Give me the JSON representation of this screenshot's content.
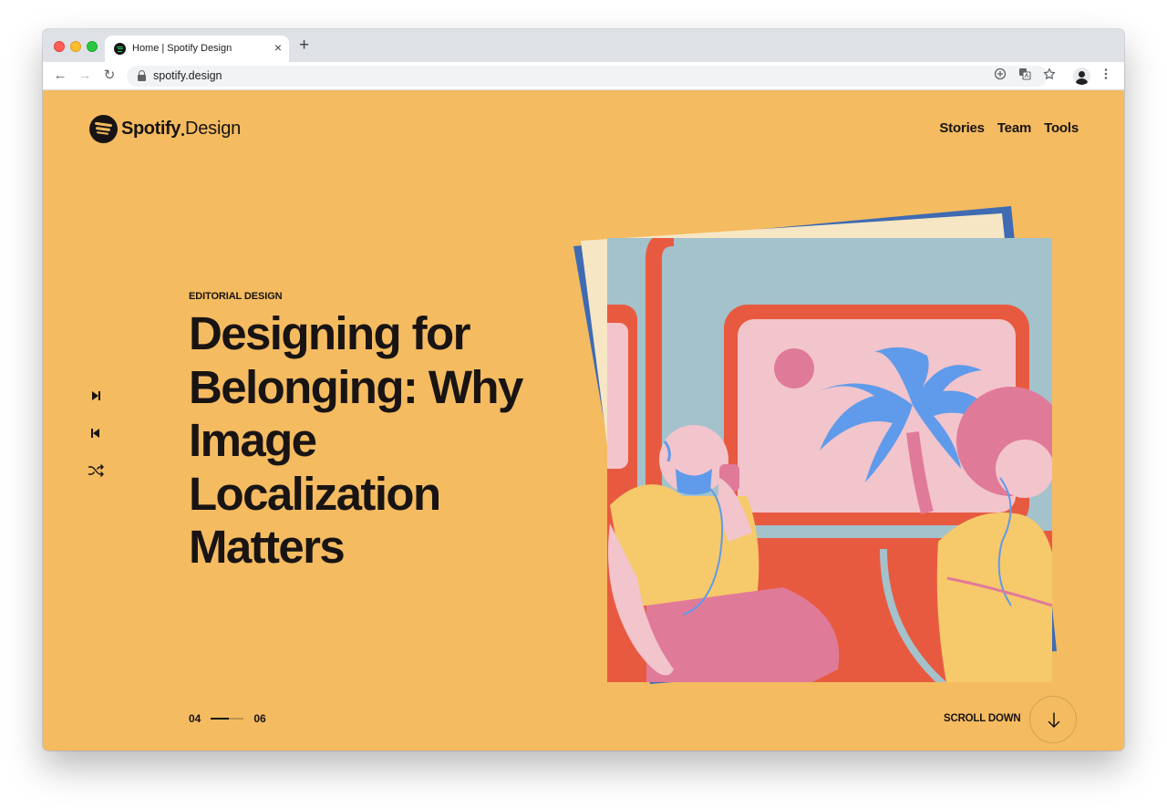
{
  "browser": {
    "tab_title": "Home | Spotify Design",
    "tab_close": "×",
    "new_tab": "+",
    "url": "spotify.design",
    "nav": {
      "back": "←",
      "forward": "→",
      "reload": "↻"
    },
    "toolbar_icons": [
      "add-circle-icon",
      "translate-icon",
      "star-icon",
      "profile-icon",
      "more-vert-icon"
    ]
  },
  "site": {
    "logo_word": "Spotify",
    "logo_sub": "Design",
    "nav": [
      {
        "label": "Stories"
      },
      {
        "label": "Team"
      },
      {
        "label": "Tools"
      }
    ]
  },
  "player_controls": [
    "skip-next-icon",
    "skip-previous-icon",
    "shuffle-icon"
  ],
  "hero": {
    "category": "EDITORIAL DESIGN",
    "title_lines": [
      "Designing for",
      "Belonging: Why",
      "Image",
      "Localization",
      "Matters"
    ]
  },
  "pager": {
    "current": "04",
    "total": "06"
  },
  "scroll": {
    "label": "SCROLL DOWN",
    "icon": "arrow-down-icon"
  },
  "colors": {
    "background": "#F4BB60",
    "text": "#191414",
    "art_sky": "#A3C2CC",
    "art_red": "#E85A40",
    "art_pink": "#E07A99",
    "art_blue": "#5F9BEA",
    "art_paper_blue": "#3F6BB3",
    "art_paper_cream": "#F6E6C4"
  }
}
